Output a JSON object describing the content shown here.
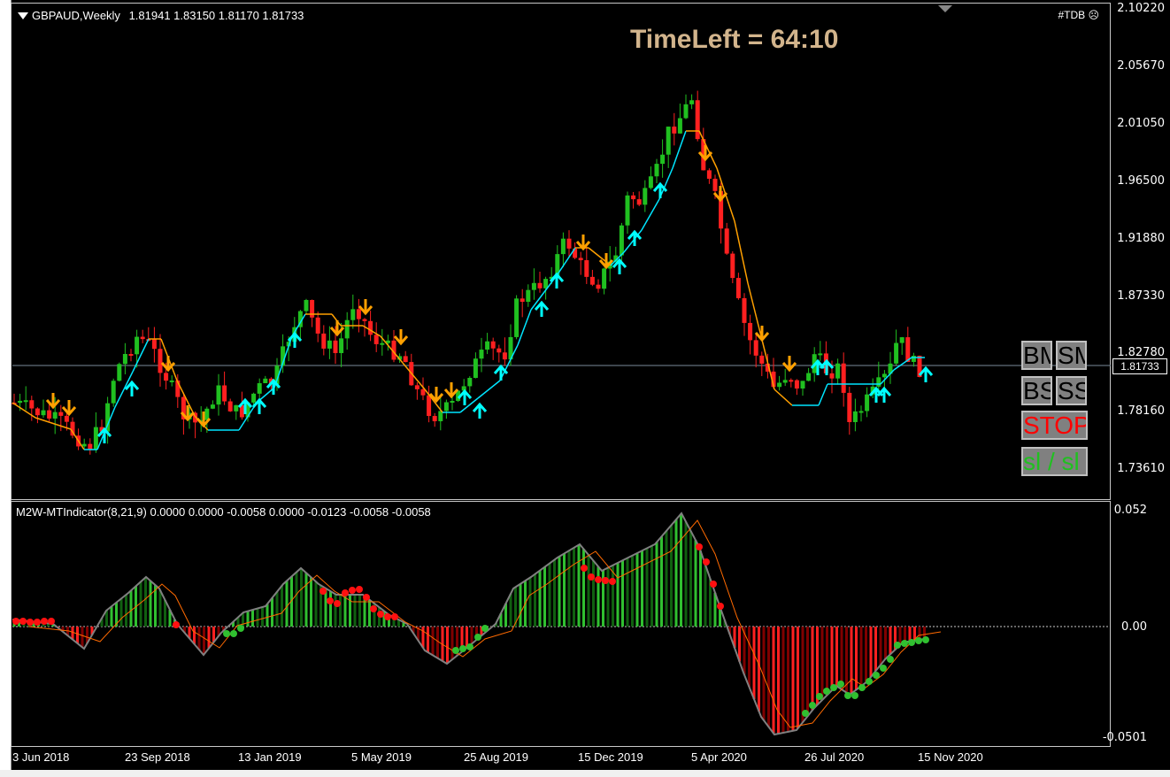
{
  "header": {
    "symbol": "GBPAUD,Weekly",
    "ohlc": "1.81941 1.83150 1.81170 1.81733",
    "timeleft": "TimeLeft = 64:10",
    "tag": "#TDB"
  },
  "price_axis": {
    "labels": [
      "2.10220",
      "2.05670",
      "2.01050",
      "1.96500",
      "1.91880",
      "1.87330",
      "1.82780",
      "1.78160",
      "1.73610"
    ],
    "current": "1.81733"
  },
  "indicator": {
    "title": "M2W-MTIndicator(8,21,9) 0.0000 0.0000 -0.0058 0.0000 -0.0123 -0.0058 -0.0058",
    "axis_labels": [
      "0.052",
      "0.00",
      "-0.0501"
    ]
  },
  "x_axis": {
    "labels": [
      "3 Jun 2018",
      "23 Sep 2018",
      "13 Jan 2019",
      "5 May 2019",
      "25 Aug 2019",
      "15 Dec 2019",
      "5 Apr 2020",
      "26 Jul 2020",
      "15 Nov 2020"
    ]
  },
  "buttons": [
    {
      "label": "BM",
      "color": "#000000"
    },
    {
      "label": "SM",
      "color": "#000000"
    },
    {
      "label": "BS",
      "color": "#000000"
    },
    {
      "label": "SS",
      "color": "#000000"
    },
    {
      "label": "STOP",
      "color": "#ff0000"
    },
    {
      "label": "sl / sl \\",
      "color": "#20c020"
    }
  ],
  "colors": {
    "bull": "#20c020",
    "bear": "#ff2020",
    "up_arrow": "#00ffff",
    "down_arrow": "#ffa000",
    "trail_up": "#00e5ff",
    "trail_down": "#ffa000"
  }
}
